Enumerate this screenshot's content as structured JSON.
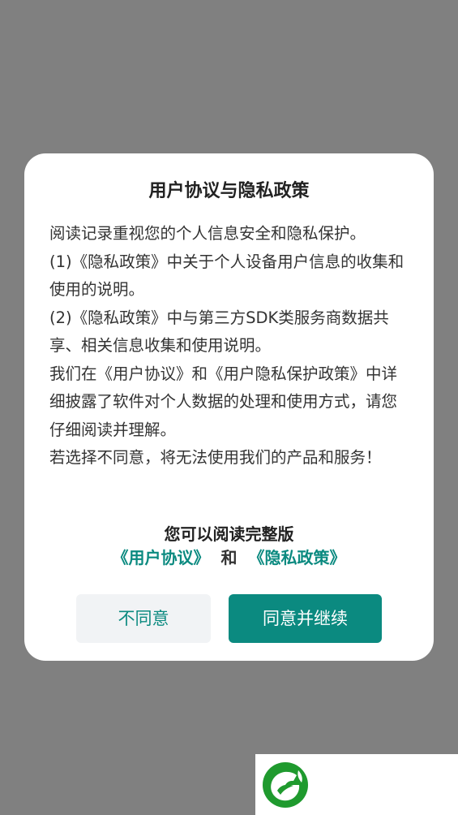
{
  "dialog": {
    "title": "用户协议与隐私政策",
    "paragraphs": [
      "阅读记录重视您的个人信息安全和隐私保护。",
      "(1)《隐私政策》中关于个人设备用户信息的收集和使用的说明。",
      "(2)《隐私政策》中与第三方SDK类服务商数据共享、相关信息收集和使用说明。",
      "我们在《用户协议》和《用户隐私保护政策》中详细披露了软件对个人数据的处理和使用方式，请您仔细阅读并理解。",
      "若选择不同意，将无法使用我们的产品和服务！"
    ],
    "read_full": "您可以阅读完整版",
    "link_user_agreement": "《用户协议》",
    "link_and": "和",
    "link_privacy_policy": "《隐私政策》",
    "decline_label": "不同意",
    "accept_label": "同意并继续"
  },
  "colors": {
    "overlay": "#808080",
    "accent": "#0b8a80",
    "decline_bg": "#f1f3f5",
    "logo_green": "#1f9a2e"
  },
  "logo": {
    "icon": "app-logo-icon"
  }
}
